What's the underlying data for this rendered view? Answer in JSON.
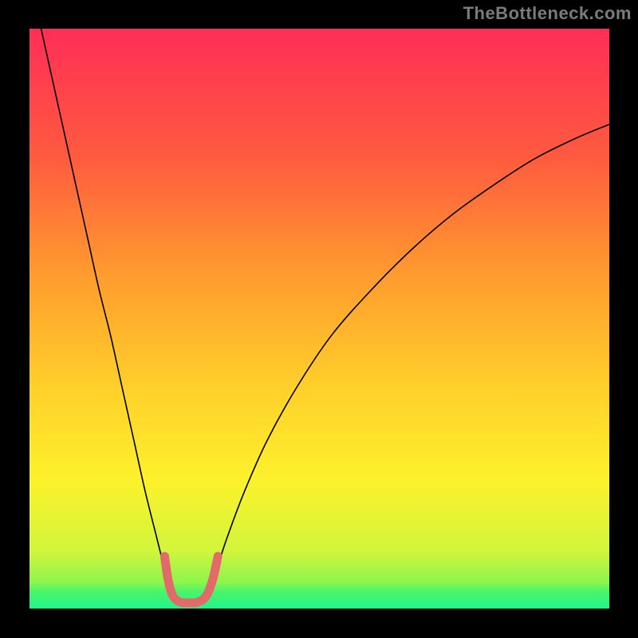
{
  "attribution": "TheBottleneck.com",
  "chart_data": {
    "type": "line",
    "title": "",
    "xlabel": "",
    "ylabel": "",
    "xlim": [
      0,
      100
    ],
    "ylim": [
      0,
      100
    ],
    "grid": false,
    "legend": false,
    "background_gradient_stops": [
      {
        "offset": 0,
        "color": "#FF2E56"
      },
      {
        "offset": 0.22,
        "color": "#FF5A3F"
      },
      {
        "offset": 0.42,
        "color": "#FF9A2E"
      },
      {
        "offset": 0.62,
        "color": "#FFD02A"
      },
      {
        "offset": 0.78,
        "color": "#FCF22B"
      },
      {
        "offset": 0.9,
        "color": "#D2F53C"
      },
      {
        "offset": 0.955,
        "color": "#8DF54C"
      },
      {
        "offset": 0.97,
        "color": "#4BF56A"
      },
      {
        "offset": 1.0,
        "color": "#1FF58A"
      }
    ],
    "series": [
      {
        "name": "left-curve",
        "color": "#000000",
        "width": 1.6,
        "x": [
          2,
          4,
          6,
          8,
          10,
          12,
          14,
          16,
          18,
          20,
          22,
          23.5,
          24.5
        ],
        "y": [
          100,
          91,
          82,
          73,
          64,
          55,
          47,
          38,
          29,
          20,
          12,
          6,
          3
        ]
      },
      {
        "name": "right-curve",
        "color": "#000000",
        "width": 1.6,
        "x": [
          30.5,
          32,
          34,
          37,
          41,
          46,
          52,
          59,
          66,
          73,
          80,
          87,
          94,
          100
        ],
        "y": [
          3,
          6,
          12,
          20,
          29,
          38,
          47,
          55,
          62,
          68,
          73,
          77.5,
          81,
          83.5
        ]
      },
      {
        "name": "valley-overlay",
        "color": "#E36A6A",
        "width": 11,
        "x": [
          23.3,
          23.9,
          24.7,
          26.0,
          27.5,
          29.0,
          30.5,
          31.6,
          32.5
        ],
        "y": [
          9.0,
          5.0,
          2.2,
          1.1,
          1.0,
          1.1,
          2.2,
          5.0,
          9.0
        ]
      }
    ]
  }
}
